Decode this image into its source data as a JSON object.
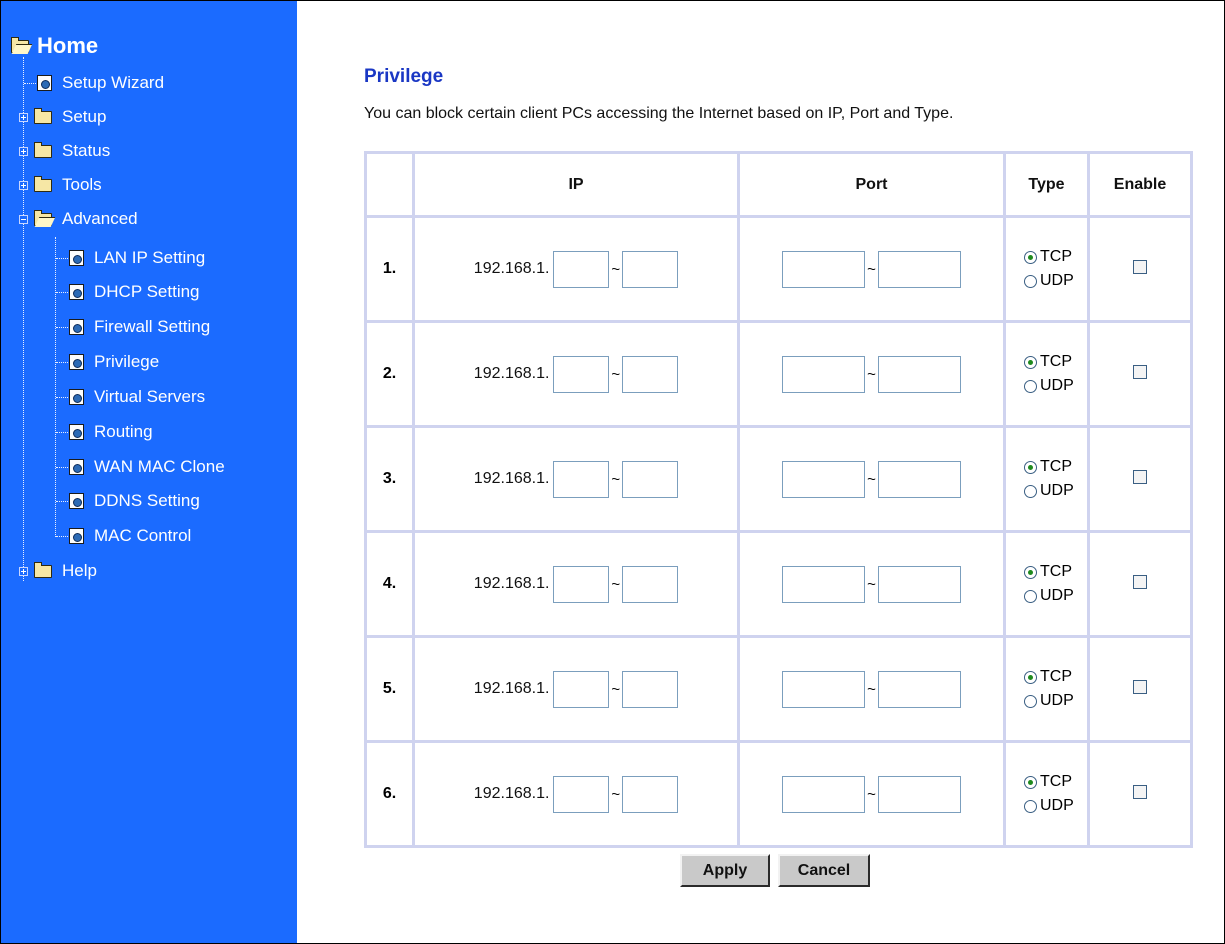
{
  "sidebar": {
    "home_label": "Home",
    "items": [
      {
        "label": "Setup Wizard",
        "kind": "page"
      },
      {
        "label": "Setup",
        "kind": "folder"
      },
      {
        "label": "Status",
        "kind": "folder"
      },
      {
        "label": "Tools",
        "kind": "folder"
      },
      {
        "label": "Advanced",
        "kind": "folder-open"
      },
      {
        "label": "LAN IP Setting",
        "kind": "page"
      },
      {
        "label": "DHCP Setting",
        "kind": "page"
      },
      {
        "label": "Firewall Setting",
        "kind": "page"
      },
      {
        "label": "Privilege",
        "kind": "page"
      },
      {
        "label": "Virtual Servers",
        "kind": "page"
      },
      {
        "label": "Routing",
        "kind": "page"
      },
      {
        "label": "WAN MAC Clone",
        "kind": "page"
      },
      {
        "label": "DDNS Setting",
        "kind": "page"
      },
      {
        "label": "MAC Control",
        "kind": "page"
      },
      {
        "label": "Help",
        "kind": "folder"
      }
    ]
  },
  "page": {
    "title": "Privilege",
    "description": "You can block certain client PCs accessing the Internet based on IP, Port and Type."
  },
  "table": {
    "headers": {
      "number": "",
      "ip": "IP",
      "port": "Port",
      "type": "Type",
      "enable": "Enable"
    },
    "ip_prefix": "192.168.1.",
    "range_sep": "~",
    "tcp_label": "TCP",
    "udp_label": "UDP",
    "rows": [
      {
        "number": "1.",
        "ip_from": "",
        "ip_to": "",
        "port_from": "",
        "port_to": "",
        "type": "TCP",
        "enabled": false
      },
      {
        "number": "2.",
        "ip_from": "",
        "ip_to": "",
        "port_from": "",
        "port_to": "",
        "type": "TCP",
        "enabled": false
      },
      {
        "number": "3.",
        "ip_from": "",
        "ip_to": "",
        "port_from": "",
        "port_to": "",
        "type": "TCP",
        "enabled": false
      },
      {
        "number": "4.",
        "ip_from": "",
        "ip_to": "",
        "port_from": "",
        "port_to": "",
        "type": "TCP",
        "enabled": false
      },
      {
        "number": "5.",
        "ip_from": "",
        "ip_to": "",
        "port_from": "",
        "port_to": "",
        "type": "TCP",
        "enabled": false
      },
      {
        "number": "6.",
        "ip_from": "",
        "ip_to": "",
        "port_from": "",
        "port_to": "",
        "type": "TCP",
        "enabled": false
      }
    ]
  },
  "buttons": {
    "apply": "Apply",
    "cancel": "Cancel"
  },
  "colors": {
    "sidebar_bg": "#1b6bff",
    "title": "#1a37c4",
    "table_border": "#cfd3ef"
  }
}
